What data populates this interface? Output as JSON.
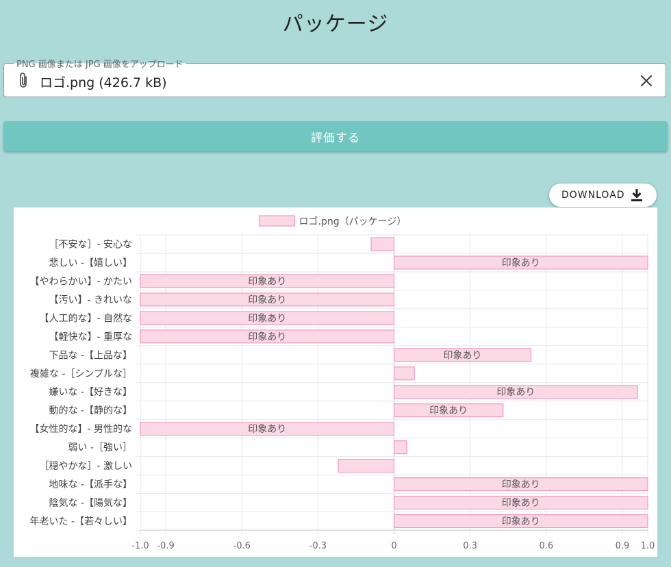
{
  "page": {
    "title": "パッケージ"
  },
  "upload": {
    "legend": "PNG 画像または JPG 画像をアップロード",
    "file_display": "ロゴ.png (426.7 kB)",
    "clip_icon": "paperclip-icon",
    "clear_icon": "close-icon"
  },
  "evaluate_button": {
    "label": "評価する"
  },
  "download_button": {
    "label": "DOWNLOAD",
    "icon": "download-icon"
  },
  "colors": {
    "background": "#acdad9",
    "accent": "#72c6c1",
    "bar_fill": "#fbd9e4",
    "bar_border": "#f39ab6"
  },
  "chart_data": {
    "type": "bar",
    "orientation": "horizontal",
    "legend": "ロゴ.png（パッケージ）",
    "legend_position": "top",
    "xlim": [
      -1.0,
      1.0
    ],
    "x_ticks": [
      "-1.0",
      "-0.9",
      "-0.6",
      "-0.3",
      "0",
      "0.3",
      "0.6",
      "0.9",
      "1.0"
    ],
    "x_tick_values": [
      -1.0,
      -0.9,
      -0.6,
      -0.3,
      0,
      0.3,
      0.6,
      0.9,
      1.0
    ],
    "grid": true,
    "categories": [
      "［不安な］- 安心な",
      "悲しい -【嬉しい】",
      "【やわらかい】- かたい",
      "【汚い】- きれいな",
      "【人工的な】- 自然な",
      "【軽快な】- 重厚な",
      "下品な -【上品な】",
      "複雑な -［シンプルな］",
      "嫌いな -【好きな】",
      "動的な -【静的な】",
      "【女性的な】- 男性的な",
      "弱い -［強い］",
      "［穏やかな］- 激しい",
      "地味な -【派手な】",
      "陰気な -【陽気な】",
      "年老いた -【若々しい】"
    ],
    "series": [
      {
        "name": "ロゴ.png（パッケージ）",
        "values": [
          -0.09,
          1.0,
          -1.0,
          -1.0,
          -1.0,
          -1.0,
          0.54,
          0.08,
          0.96,
          0.43,
          -1.0,
          0.05,
          -0.22,
          1.0,
          1.0,
          1.0
        ],
        "labels": [
          "",
          "印象あり",
          "印象あり",
          "印象あり",
          "印象あり",
          "印象あり",
          "印象あり",
          "",
          "印象あり",
          "印象あり",
          "印象あり",
          "",
          "",
          "印象あり",
          "印象あり",
          "印象あり"
        ]
      }
    ]
  }
}
